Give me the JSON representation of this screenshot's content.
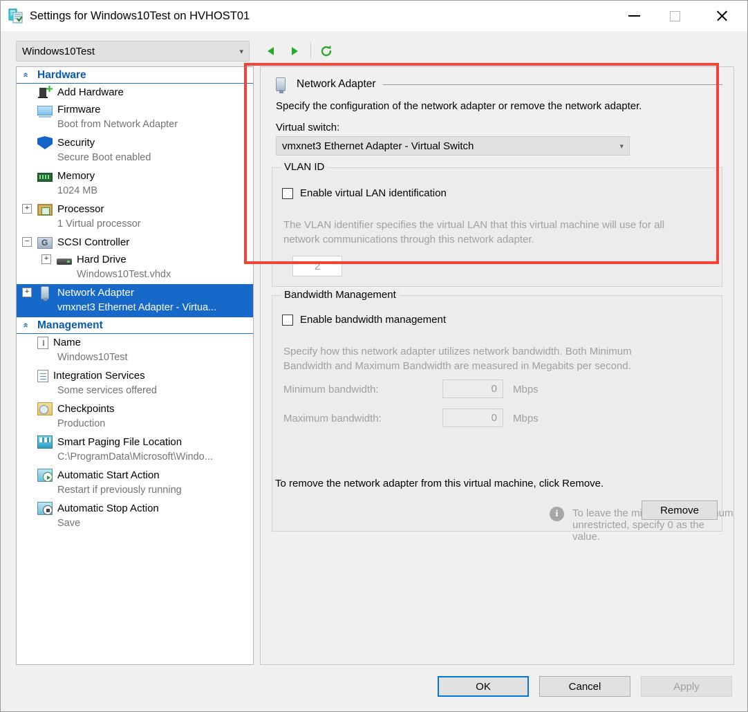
{
  "window": {
    "title": "Settings for Windows10Test on HVHOST01",
    "icon": "settings-vm-icon",
    "minimize": "—",
    "maximize": "maximize-icon",
    "close": "close-icon"
  },
  "toolbar": {
    "vm_selector_value": "Windows10Test",
    "prev": "previous-icon",
    "next": "next-icon",
    "refresh": "refresh-icon"
  },
  "sidebar": {
    "groups": [
      {
        "label": "Hardware",
        "collapse_icon": "chevron-up-icon",
        "items": [
          {
            "label": "Add Hardware",
            "sub": "",
            "icon": "add-hardware-icon",
            "expander": "",
            "level": 1,
            "selected": false
          },
          {
            "label": "Firmware",
            "sub": "Boot from Network Adapter",
            "icon": "firmware-icon",
            "expander": "",
            "level": 1,
            "selected": false
          },
          {
            "label": "Security",
            "sub": "Secure Boot enabled",
            "icon": "security-shield-icon",
            "expander": "",
            "level": 1,
            "selected": false
          },
          {
            "label": "Memory",
            "sub": "1024 MB",
            "icon": "memory-icon",
            "expander": "",
            "level": 1,
            "selected": false
          },
          {
            "label": "Processor",
            "sub": "1 Virtual processor",
            "icon": "processor-icon",
            "expander": "+",
            "level": 1,
            "selected": false
          },
          {
            "label": "SCSI Controller",
            "sub": "",
            "icon": "scsi-controller-icon",
            "expander": "−",
            "level": 1,
            "selected": false
          },
          {
            "label": "Hard Drive",
            "sub": "Windows10Test.vhdx",
            "icon": "hard-drive-icon",
            "expander": "+",
            "level": 2,
            "selected": false
          },
          {
            "label": "Network Adapter",
            "sub": "vmxnet3 Ethernet Adapter - Virtua...",
            "icon": "network-adapter-icon",
            "expander": "+",
            "level": 1,
            "selected": true
          }
        ]
      },
      {
        "label": "Management",
        "collapse_icon": "chevron-up-icon",
        "items": [
          {
            "label": "Name",
            "sub": "Windows10Test",
            "icon": "name-icon",
            "expander": "",
            "level": 1,
            "selected": false
          },
          {
            "label": "Integration Services",
            "sub": "Some services offered",
            "icon": "integration-services-icon",
            "expander": "",
            "level": 1,
            "selected": false
          },
          {
            "label": "Checkpoints",
            "sub": "Production",
            "icon": "checkpoints-icon",
            "expander": "",
            "level": 1,
            "selected": false
          },
          {
            "label": "Smart Paging File Location",
            "sub": "C:\\ProgramData\\Microsoft\\Windo...",
            "icon": "smart-paging-icon",
            "expander": "",
            "level": 1,
            "selected": false
          },
          {
            "label": "Automatic Start Action",
            "sub": "Restart if previously running",
            "icon": "auto-start-icon",
            "expander": "",
            "level": 1,
            "selected": false
          },
          {
            "label": "Automatic Stop Action",
            "sub": "Save",
            "icon": "auto-stop-icon",
            "expander": "",
            "level": 1,
            "selected": false
          }
        ]
      }
    ]
  },
  "panel": {
    "header": "Network Adapter",
    "header_icon": "network-adapter-icon",
    "intro": "Specify the configuration of the network adapter or remove the network adapter.",
    "virtual_switch_label": "Virtual switch:",
    "virtual_switch_value": "vmxnet3 Ethernet Adapter - Virtual Switch",
    "vlan": {
      "group_title": "VLAN ID",
      "checkbox_label": "Enable virtual LAN identification",
      "checkbox_checked": false,
      "help_line1": "The VLAN identifier specifies the virtual LAN that this virtual machine will use for all",
      "help_line2": "network communications through this network adapter.",
      "vlan_id_value": "2"
    },
    "bandwidth": {
      "group_title": "Bandwidth Management",
      "checkbox_label": "Enable bandwidth management",
      "checkbox_checked": false,
      "help_line1": "Specify how this network adapter utilizes network bandwidth. Both Minimum",
      "help_line2": "Bandwidth and Maximum Bandwidth are measured in Megabits per second.",
      "min_label": "Minimum bandwidth:",
      "min_value": "0",
      "min_unit": "Mbps",
      "max_label": "Maximum bandwidth:",
      "max_value": "0",
      "max_unit": "Mbps",
      "info_icon": "info-icon",
      "info_text": "To leave the minimum or maximum unrestricted, specify 0 as the value."
    },
    "remove_note": "To remove the network adapter from this virtual machine, click Remove.",
    "remove_button": "Remove"
  },
  "footer": {
    "ok": "OK",
    "cancel": "Cancel",
    "apply": "Apply",
    "apply_disabled": true
  },
  "annotation": {
    "type": "red-highlight-rectangle",
    "color": "#f44336"
  }
}
